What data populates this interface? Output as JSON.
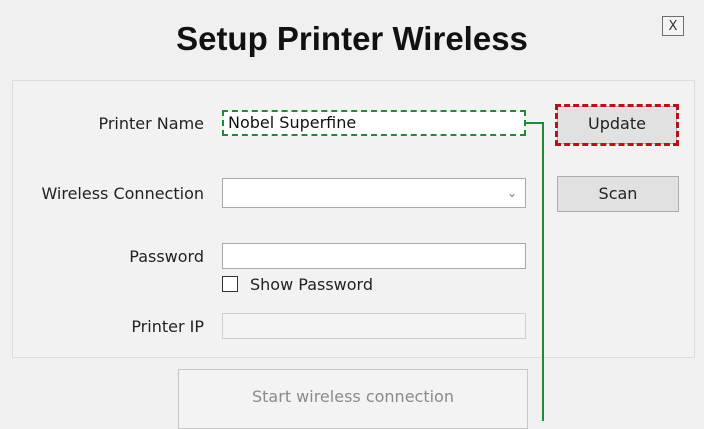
{
  "window": {
    "title": "Setup Printer Wireless",
    "close_label": "X"
  },
  "form": {
    "printer_name_label": "Printer Name",
    "printer_name_value": "Nobel Superfine",
    "wireless_connection_label": "Wireless Connection",
    "wireless_connection_value": "",
    "password_label": "Password",
    "password_value": "",
    "show_password_label": "Show Password",
    "show_password_checked": false,
    "printer_ip_label": "Printer IP",
    "printer_ip_value": ""
  },
  "buttons": {
    "update_label": "Update",
    "scan_label": "Scan",
    "start_label": "Start wireless connection"
  },
  "icons": {
    "dropdown": "chevron-down-icon",
    "dropdown_glyph": "⌄"
  },
  "colors": {
    "highlight_green": "#1f8b3a",
    "highlight_red": "#b5131a"
  }
}
